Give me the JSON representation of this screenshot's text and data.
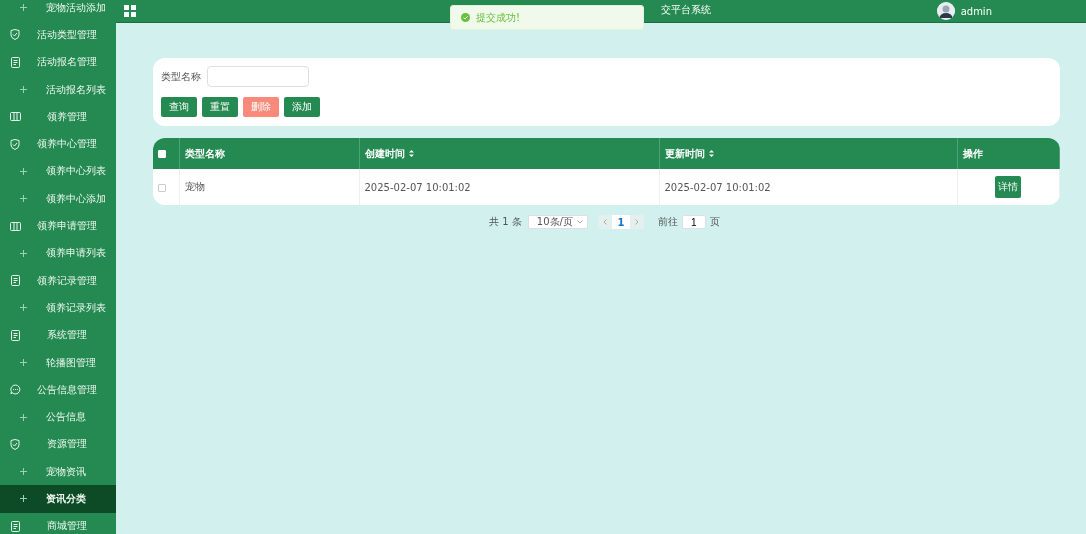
{
  "sidebar": {
    "items": [
      {
        "kind": "sub",
        "label": "宠物活动添加",
        "selected": false
      },
      {
        "kind": "shield",
        "label": "活动类型管理",
        "selected": false
      },
      {
        "kind": "doc",
        "label": "活动报名管理",
        "selected": false
      },
      {
        "kind": "sub",
        "label": "活动报名列表",
        "selected": false
      },
      {
        "kind": "columns",
        "label": "领养管理",
        "selected": false
      },
      {
        "kind": "shield",
        "label": "领养中心管理",
        "selected": false
      },
      {
        "kind": "sub",
        "label": "领养中心列表",
        "selected": false
      },
      {
        "kind": "sub",
        "label": "领养中心添加",
        "selected": false
      },
      {
        "kind": "columns",
        "label": "领养申请管理",
        "selected": false
      },
      {
        "kind": "sub",
        "label": "领养申请列表",
        "selected": false
      },
      {
        "kind": "doc",
        "label": "领养记录管理",
        "selected": false
      },
      {
        "kind": "sub",
        "label": "领养记录列表",
        "selected": false
      },
      {
        "kind": "doc",
        "label": "系统管理",
        "selected": false
      },
      {
        "kind": "sub",
        "label": "轮播图管理",
        "selected": false
      },
      {
        "kind": "chat",
        "label": "公告信息管理",
        "selected": false
      },
      {
        "kind": "sub",
        "label": "公告信息",
        "selected": false
      },
      {
        "kind": "shield",
        "label": "资源管理",
        "selected": false
      },
      {
        "kind": "sub",
        "label": "宠物资讯",
        "selected": false
      },
      {
        "kind": "sub",
        "label": "资讯分类",
        "selected": true
      },
      {
        "kind": "doc",
        "label": "商城管理",
        "selected": false
      }
    ]
  },
  "topbar": {
    "title": "交平台系统",
    "user": "admin"
  },
  "toast": {
    "message": "提交成功!"
  },
  "search": {
    "label": "类型名称",
    "buttons": [
      {
        "label": "查询",
        "kind": "primary"
      },
      {
        "label": "重置",
        "kind": "primary"
      },
      {
        "label": "删除",
        "kind": "danger"
      },
      {
        "label": "添加",
        "kind": "primary"
      }
    ]
  },
  "table": {
    "select_all_checked": false,
    "columns": [
      {
        "label": "类型名称",
        "sortable": false
      },
      {
        "label": "创建时间",
        "sortable": true
      },
      {
        "label": "更新时间",
        "sortable": true
      },
      {
        "label": "操作",
        "sortable": false
      }
    ],
    "rows": [
      {
        "checked": false,
        "cells": [
          "宠物",
          "2025-02-07 10:01:02",
          "2025-02-07 10:01:02"
        ],
        "action": "详情"
      }
    ]
  },
  "pagination": {
    "total": "共 1 条",
    "page_size": "10条/页",
    "pages": [
      {
        "label": "1",
        "selected": true
      }
    ],
    "goto_label": "前往",
    "goto_value": "1",
    "goto_suffix": "页"
  }
}
